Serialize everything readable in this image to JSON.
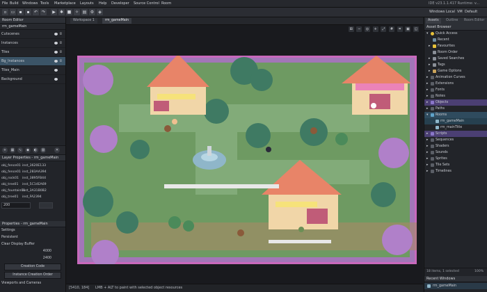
{
  "menubar": {
    "items": [
      "File",
      "Build",
      "Windows",
      "Tools",
      "Marketplace",
      "Layouts",
      "Help",
      "Developer",
      "Source Control",
      "Room"
    ],
    "version": "IDE v23.1.1.417  Runtime: v..."
  },
  "toolbar": {
    "right": [
      "Windows",
      "Local",
      "VM",
      "Default",
      "Gam..."
    ]
  },
  "left_panel": {
    "layers_title": "Room Editor",
    "room_name": "rm_gameMain",
    "layers": [
      "Cutscenes",
      "Instances",
      "Tiles",
      "Bg_Instances",
      "Tiles_Main",
      "Background"
    ],
    "layer_props_title": "Layer Properties - rm_gameMain",
    "instances": [
      {
        "obj": "obj_fence01",
        "id": "inst_3620E133"
      },
      {
        "obj": "obj_fence01",
        "id": "inst_283AA394"
      },
      {
        "obj": "obj_rock01",
        "id": "inst_3895FB44"
      },
      {
        "obj": "obj_tree01",
        "id": "inst_5C14EA69"
      },
      {
        "obj": "obj_fountain01",
        "id": "inst_3A31B0B2"
      },
      {
        "obj": "obj_tree01",
        "id": "inst_FA2394"
      }
    ],
    "pos_value": "200",
    "room_props_title": "Properties - rm_gameMain",
    "settings_label": "Settings",
    "persistent_label": "Persistent",
    "clear_display_label": "Clear Display Buffer",
    "width_value": "4000",
    "height_value": "2400",
    "buttons": [
      "Creation Code",
      "Instance Creation Order"
    ],
    "viewports_label": "Viewports and Cameras"
  },
  "workspace": {
    "tabs": [
      "Workspace 1",
      "rm_gameMain"
    ],
    "status_coords": "[5410, 184]",
    "status_hint": "LMB + ALT to paint with selected object resources"
  },
  "right_panel": {
    "tabs": [
      "Assets",
      "Outline",
      "Room Editor"
    ],
    "title": "Asset Browser",
    "quick_access": "Quick Access",
    "tree": [
      {
        "label": "Recent",
        "level": 2
      },
      {
        "label": "Favourites",
        "level": 2
      },
      {
        "label": "Room Order",
        "level": 2
      },
      {
        "label": "Saved Searches",
        "level": 2
      },
      {
        "label": "Tags",
        "level": 2
      },
      {
        "label": "Game Options",
        "level": 2
      },
      {
        "label": "Animation Curves",
        "level": 1
      },
      {
        "label": "Extensions",
        "level": 1
      },
      {
        "label": "Fonts",
        "level": 1
      },
      {
        "label": "Notes",
        "level": 1
      },
      {
        "label": "Objects",
        "level": 1,
        "hl": "#4b3f73"
      },
      {
        "label": "Paths",
        "level": 1
      },
      {
        "label": "Rooms",
        "level": 1,
        "hl": "#2f4b5e"
      },
      {
        "label": "rm_gameMain",
        "level": 3,
        "hl": "#26404f"
      },
      {
        "label": "rm_mainTitle",
        "level": 3
      },
      {
        "label": "Scripts",
        "level": 1,
        "hl": "#4b3f73"
      },
      {
        "label": "Sequences",
        "level": 1
      },
      {
        "label": "Shaders",
        "level": 1
      },
      {
        "label": "Sounds",
        "level": 1
      },
      {
        "label": "Sprites",
        "level": 1
      },
      {
        "label": "Tile Sets",
        "level": 1
      },
      {
        "label": "Timelines",
        "level": 1
      }
    ],
    "footer_count": "18 items, 1 selected",
    "footer_zoom": "100%",
    "recent_title": "Recent Windows",
    "recent_item": "rm_gameMain"
  },
  "colors": {
    "purple": "#b46ad6",
    "pink": "#e85fbf",
    "grass": "#6e9a62",
    "roof": "#e88468",
    "tree": "#3f7a63"
  }
}
